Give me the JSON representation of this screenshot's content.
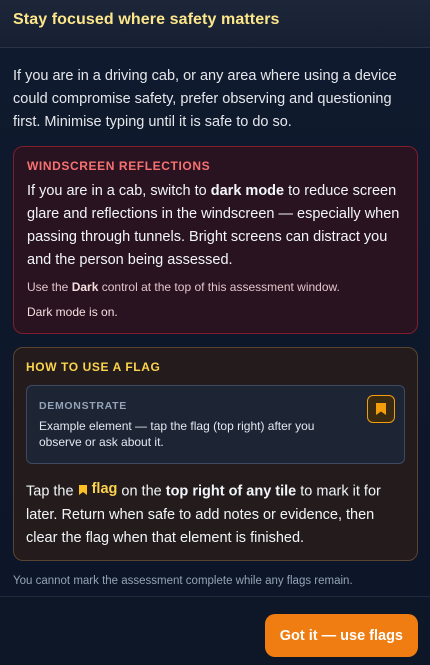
{
  "header": {
    "title": "Stay focused where safety matters"
  },
  "intro": {
    "text": "If you are in a driving cab, or any area where using a device could compromise safety, prefer observing and questioning first. Minimise typing until it is safe to do so."
  },
  "reflections_card": {
    "title": "WINDSCREEN REFLECTIONS",
    "body_part1": "If you are in a cab, switch to ",
    "body_bold": "dark mode",
    "body_part2": " to reduce screen glare and reflections in the windscreen — especially when passing through tunnels. Bright screens can distract you and the person being assessed.",
    "note_part1": "Use the ",
    "note_bold": "Dark",
    "note_part2": " control at the top of this assessment window.",
    "status": "Dark mode is on."
  },
  "flag_card": {
    "title": "HOW TO USE A FLAG",
    "demo_label": "DEMONSTRATE",
    "demo_text": "Example element — tap the flag (top right) after you observe or ask about it.",
    "text_part1": "Tap the ",
    "flag_word": "flag",
    "text_part2": " on the ",
    "text_bold": "top right of any tile",
    "text_part3": " to mark it for later. Return when safe to add notes or evidence, then clear the flag when that element is finished."
  },
  "footnote": "You cannot mark the assessment complete while any flags remain.",
  "footer": {
    "cta_label": "Got it — use flags"
  },
  "colors": {
    "accent": "#f07d12",
    "flag": "#fcd34d",
    "warning": "#f87171",
    "title": "#fde68a"
  },
  "icons": {
    "flag_button": "bookmark-flag-icon",
    "inline_flag": "bookmark-flag-icon"
  }
}
